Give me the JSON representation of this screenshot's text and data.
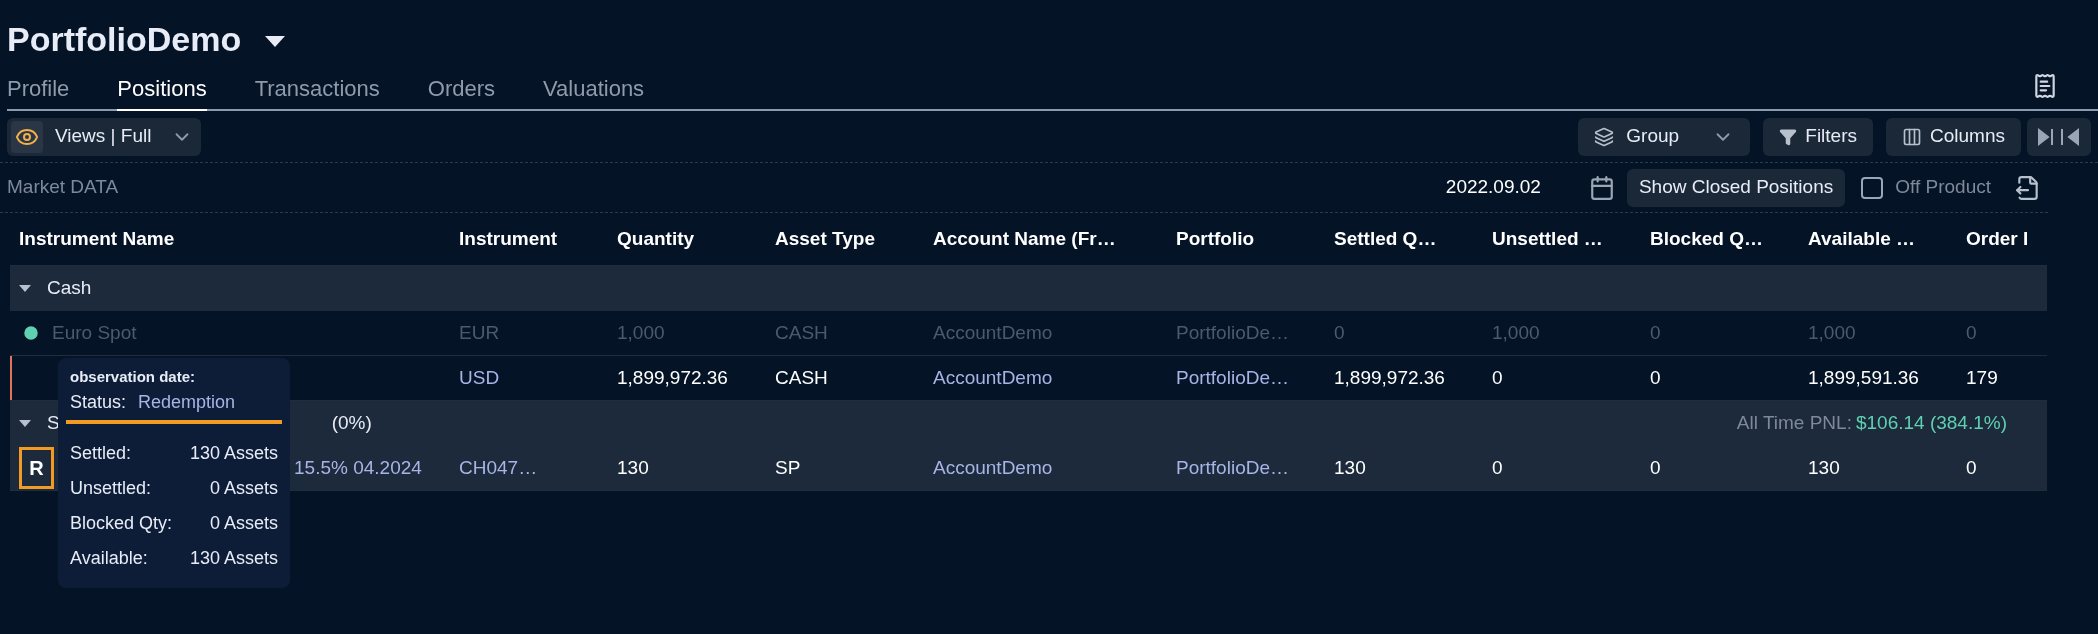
{
  "portfolio": {
    "title": "PortfolioDemo"
  },
  "tabs": [
    {
      "label": "Profile",
      "selected": false
    },
    {
      "label": "Positions",
      "selected": true
    },
    {
      "label": "Transactions",
      "selected": false
    },
    {
      "label": "Orders",
      "selected": false
    },
    {
      "label": "Valuations",
      "selected": false
    }
  ],
  "toolbar": {
    "views": "Views | Full",
    "group": "Group",
    "filters": "Filters",
    "columns": "Columns"
  },
  "market_data": {
    "label": "Market DATA",
    "date": "2022.09.02",
    "show_closed": "Show Closed Positions",
    "off_product": {
      "label": "Off Product",
      "checked": false
    }
  },
  "table": {
    "columns": [
      "Instrument Name",
      "Instrument",
      "Quantity",
      "Asset Type",
      "Account Name (Fr…",
      "Portfolio",
      "Settled Q…",
      "Unsettled …",
      "Blocked Q…",
      "Available …",
      "Order I"
    ],
    "groups": [
      {
        "label": "Cash",
        "expanded": true,
        "rows": [
          {
            "pending": true,
            "flagged": false,
            "badge": "",
            "cells": [
              "Euro Spot",
              "EUR",
              "1,000",
              "CASH",
              "AccountDemo",
              "PortfolioDe…",
              "0",
              "1,000",
              "0",
              "1,000",
              "0"
            ]
          },
          {
            "pending": false,
            "flagged": true,
            "badge": "",
            "cells": [
              null,
              "USD",
              "1,899,972.36",
              "CASH",
              "AccountDemo",
              "PortfolioDe…",
              "1,899,972.36",
              "0",
              "0",
              "1,899,591.36",
              "179"
            ]
          }
        ]
      },
      {
        "label": "S",
        "suffix": "(0%)",
        "expanded": true,
        "pnl_label": "All Time PNL:",
        "pnl_value": "$106.14 (384.1%)",
        "rows": [
          {
            "pending": false,
            "flagged": false,
            "badge": "R",
            "cells": [
              "15.5% 04.2024",
              "CH047…",
              "130",
              "SP",
              "AccountDemo",
              "PortfolioDe…",
              "130",
              "0",
              "0",
              "130",
              "0"
            ]
          }
        ]
      }
    ]
  },
  "tooltip": {
    "heading": "observation date:",
    "status_label": "Status:",
    "status_value": "Redemption",
    "lines": [
      {
        "label": "Settled:",
        "value": "130 Assets"
      },
      {
        "label": "Unsettled:",
        "value": "0 Assets"
      },
      {
        "label": "Blocked Qty:",
        "value": "0 Assets"
      },
      {
        "label": "Available:",
        "value": "130 Assets"
      }
    ]
  }
}
